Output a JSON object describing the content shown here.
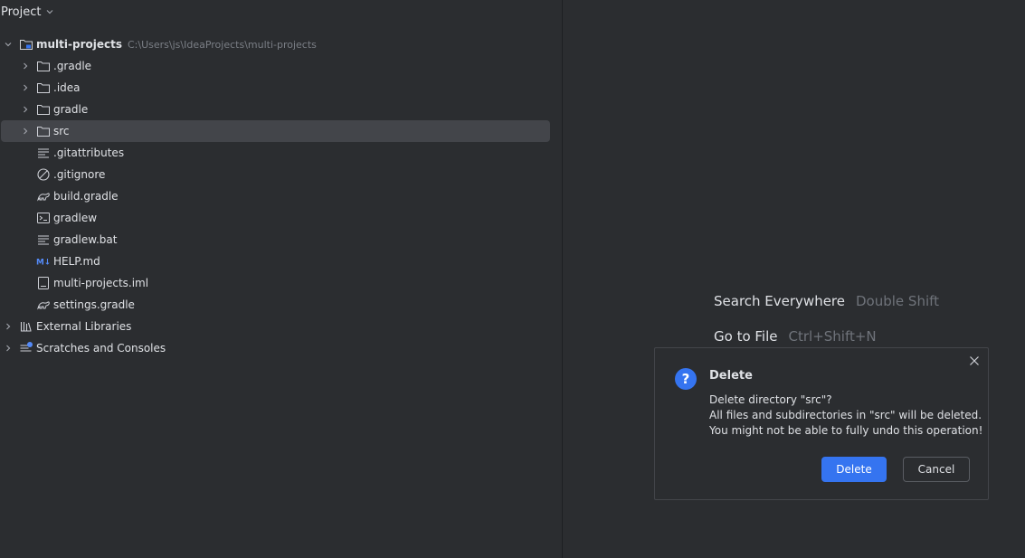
{
  "panel": {
    "title": "Project"
  },
  "tree": {
    "root": {
      "name": "multi-projects",
      "path": "C:\\Users\\js\\IdeaProjects\\multi-projects",
      "icon": "module-folder-icon"
    },
    "items": [
      {
        "label": ".gradle",
        "icon": "folder-icon",
        "expandable": true
      },
      {
        "label": ".idea",
        "icon": "folder-icon",
        "expandable": true
      },
      {
        "label": "gradle",
        "icon": "folder-icon",
        "expandable": true
      },
      {
        "label": "src",
        "icon": "folder-icon",
        "expandable": true,
        "selected": true
      },
      {
        "label": ".gitattributes",
        "icon": "text-file-icon"
      },
      {
        "label": ".gitignore",
        "icon": "ignore-file-icon"
      },
      {
        "label": "build.gradle",
        "icon": "gradle-icon"
      },
      {
        "label": "gradlew",
        "icon": "terminal-file-icon"
      },
      {
        "label": "gradlew.bat",
        "icon": "text-file-icon"
      },
      {
        "label": "HELP.md",
        "icon": "markdown-icon"
      },
      {
        "label": "multi-projects.iml",
        "icon": "iml-file-icon"
      },
      {
        "label": "settings.gradle",
        "icon": "gradle-icon"
      }
    ],
    "bottom": [
      {
        "label": "External Libraries",
        "icon": "libraries-icon"
      },
      {
        "label": "Scratches and Consoles",
        "icon": "scratches-icon"
      }
    ]
  },
  "editor": {
    "hints": [
      {
        "action": "Search Everywhere",
        "key": "Double Shift"
      },
      {
        "action": "Go to File",
        "key": "Ctrl+Shift+N"
      }
    ]
  },
  "dialog": {
    "title": "Delete",
    "message_line1": "Delete directory \"src\"?",
    "message_line2": "All files and subdirectories in \"src\" will be deleted.",
    "message_line3": "You might not be able to fully undo this operation!",
    "icon_glyph": "?",
    "confirm_label": "Delete",
    "cancel_label": "Cancel"
  },
  "colors": {
    "accent": "#3574f0",
    "background": "#2b2d30",
    "selection": "#43454a"
  }
}
